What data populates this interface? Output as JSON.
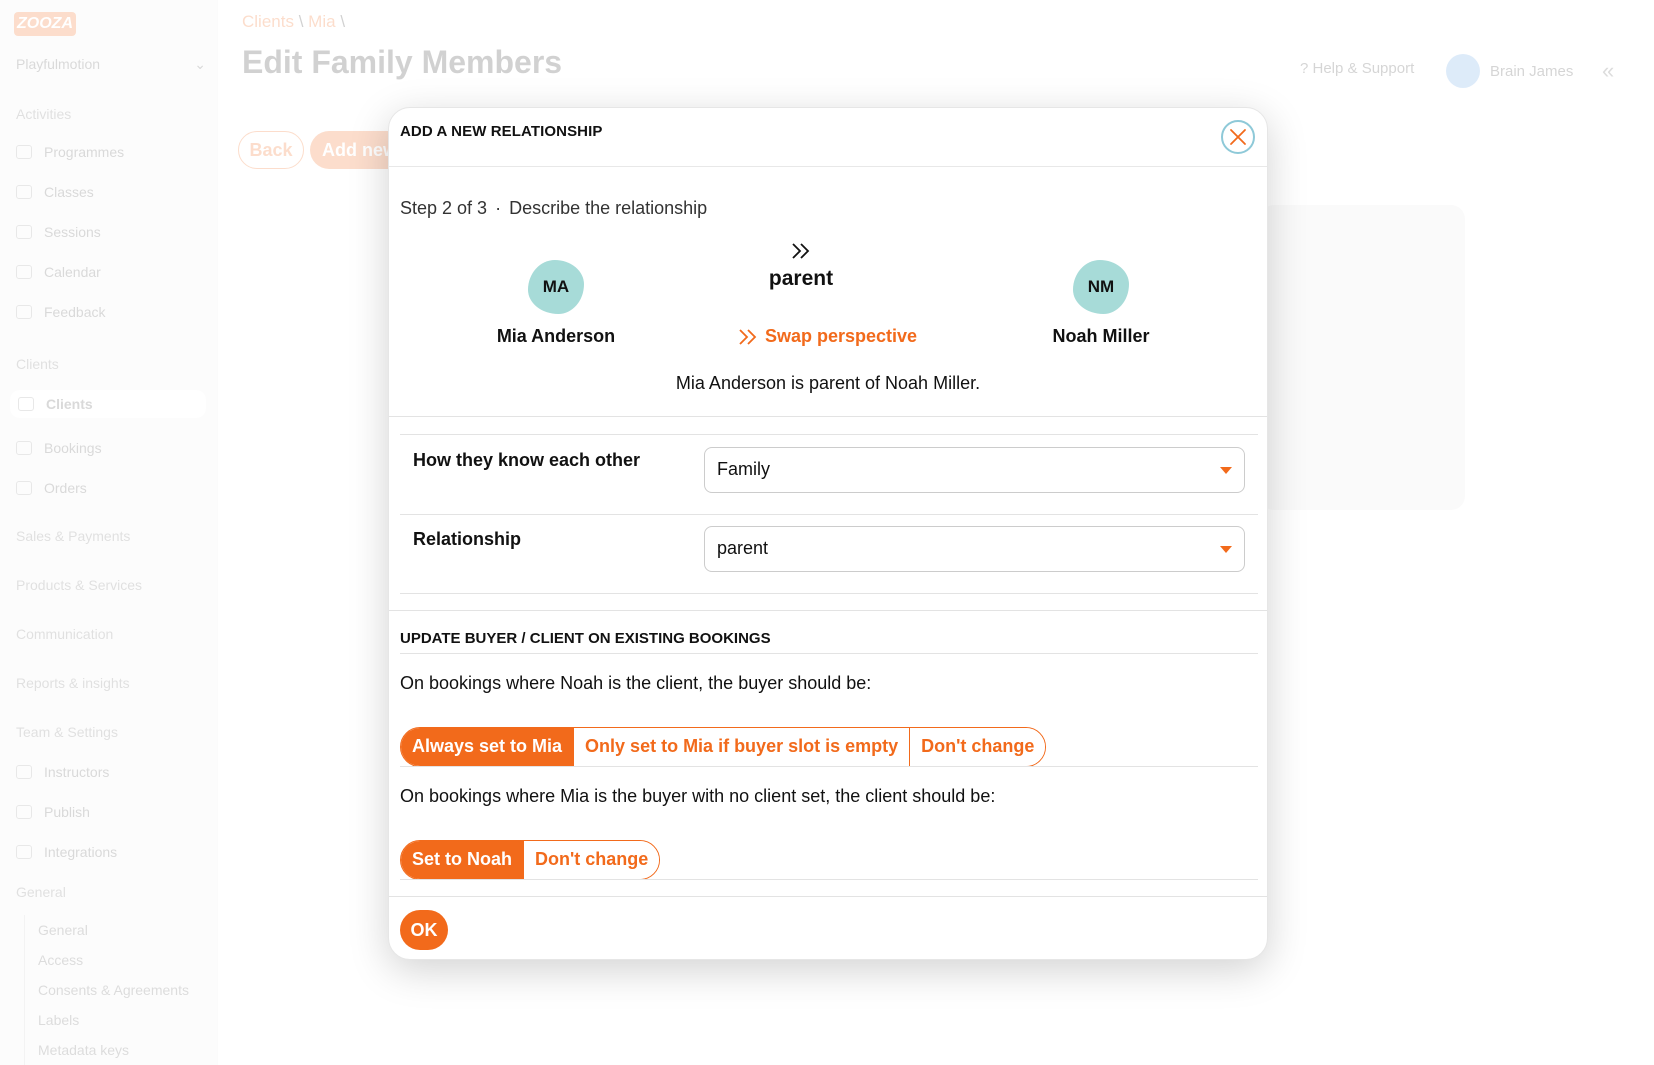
{
  "app": {
    "logo_text": "ZOOZA",
    "org_name": "Playfulmotion",
    "breadcrumb": [
      "Clients",
      "Mia"
    ],
    "page_title": "Edit Family Members",
    "help_label": "? Help & Support",
    "user_name": "Brain James",
    "back_label": "Back",
    "add_new_label": "Add new",
    "sidebar": {
      "sections": [
        {
          "title": "Activities",
          "items": [
            "Programmes",
            "Classes",
            "Sessions",
            "Calendar",
            "Feedback"
          ]
        },
        {
          "title": "Clients",
          "items": [
            "Clients",
            "Bookings",
            "Orders"
          ]
        },
        {
          "title": "Sales & Payments",
          "items": []
        },
        {
          "title": "Products & Services",
          "items": []
        },
        {
          "title": "Communication",
          "items": []
        },
        {
          "title": "Reports & insights",
          "items": []
        },
        {
          "title": "Team & Settings",
          "items": [
            "Instructors",
            "Publish",
            "Integrations"
          ]
        },
        {
          "title": "General",
          "items": []
        }
      ],
      "general_sub": [
        "General",
        "Access",
        "Consents & Agreements",
        "Labels",
        "Metadata keys"
      ]
    }
  },
  "modal": {
    "title": "ADD A NEW RELATIONSHIP",
    "step": "Step 2 of 3",
    "step_desc": "Describe the relationship",
    "left": {
      "initials": "MA",
      "name": "Mia Anderson"
    },
    "right": {
      "initials": "NM",
      "name": "Noah Miller"
    },
    "relation_word": "parent",
    "swap_label": "Swap perspective",
    "sentence": "Mia Anderson is parent of Noah Miller.",
    "how_label": "How they know each other",
    "how_value": "Family",
    "relationship_label": "Relationship",
    "relationship_value": "parent",
    "update_title": "UPDATE BUYER / CLIENT ON EXISTING BOOKINGS",
    "q1": "On bookings where Noah is the client, the buyer should be:",
    "q1_options": [
      "Always set to Mia",
      "Only set to Mia if buyer slot is empty",
      "Don't change"
    ],
    "q2": "On bookings where Mia is the buyer with no client set, the client should be:",
    "q2_options": [
      "Set to Noah",
      "Don't change"
    ],
    "ok_label": "OK"
  },
  "colors": {
    "accent": "#f26a1b",
    "avatar": "#a7dbd8",
    "close_ring": "#8ec9d8"
  }
}
